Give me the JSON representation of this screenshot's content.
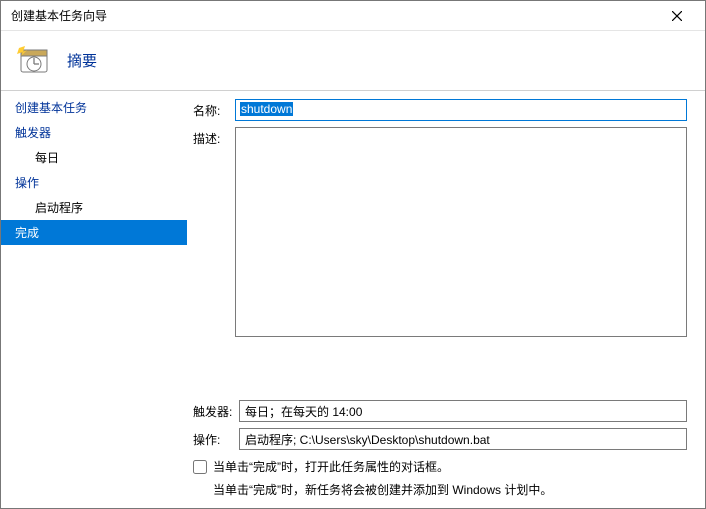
{
  "window": {
    "title": "创建基本任务向导"
  },
  "header": {
    "title": "摘要"
  },
  "sidebar": {
    "items": [
      {
        "label": "创建基本任务",
        "type": "link"
      },
      {
        "label": "触发器",
        "type": "link"
      },
      {
        "label": "每日",
        "type": "sub"
      },
      {
        "label": "操作",
        "type": "link"
      },
      {
        "label": "启动程序",
        "type": "sub"
      },
      {
        "label": "完成",
        "type": "active"
      }
    ]
  },
  "form": {
    "name_label": "名称:",
    "name_value": "shutdown",
    "desc_label": "描述:",
    "desc_value": "",
    "trigger_label": "触发器:",
    "trigger_value": "每日；在每天的 14:00",
    "action_label": "操作:",
    "action_value": "启动程序; C:\\Users\\sky\\Desktop\\shutdown.bat",
    "open_props_label": "当单击“完成”时，打开此任务属性的对话框。",
    "info_text": "当单击“完成”时，新任务将会被创建并添加到 Windows 计划中。"
  }
}
